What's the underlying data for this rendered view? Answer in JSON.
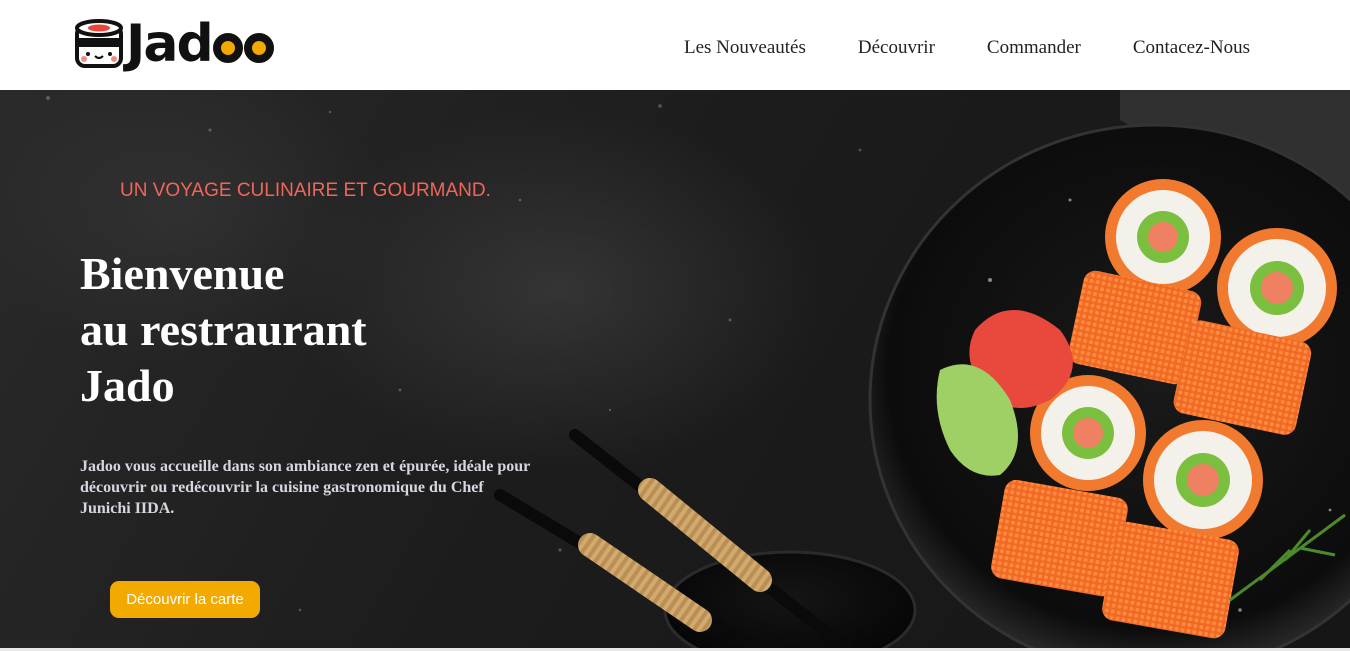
{
  "brand": {
    "name_prefix": "Jad",
    "logo_icon": "sushi-mascot-icon",
    "accent_color": "#f2a900"
  },
  "nav": {
    "items": [
      {
        "label": "Les Nouveautés"
      },
      {
        "label": "Découvrir"
      },
      {
        "label": "Commander"
      },
      {
        "label": "Contacez-Nous"
      }
    ]
  },
  "hero": {
    "tagline": "UN VOYAGE CULINAIRE ET GOURMAND.",
    "title_lines": [
      "Bienvenue",
      "au restraurant",
      "Jado"
    ],
    "description": "Jadoo vous accueille dans son ambiance zen et épurée, idéale pour découvrir ou redécouvrir la cuisine gastronomique du Chef Junichi IIDA.",
    "cta_label": "Découvrir la carte",
    "tagline_color": "#f0665a",
    "image_subject": "sushi-plate-illustration"
  }
}
